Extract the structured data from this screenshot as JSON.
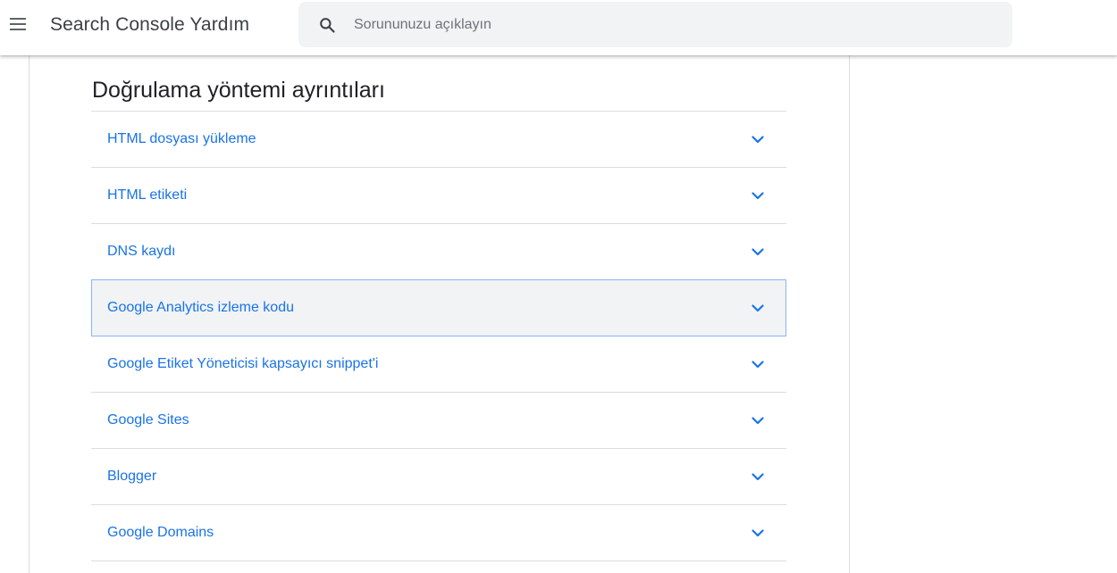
{
  "header": {
    "app_title": "Search Console Yardım",
    "menu_icon": "hamburger-menu-icon",
    "search": {
      "icon": "search-icon",
      "placeholder": "Sorununuzu açıklayın",
      "value": ""
    }
  },
  "main": {
    "section_title": "Doğrulama yöntemi ayrıntıları",
    "accordion": {
      "items": [
        {
          "label": "HTML dosyası yükleme"
        },
        {
          "label": "HTML etiketi"
        },
        {
          "label": "DNS kaydı"
        },
        {
          "label": "Google Analytics izleme kodu"
        },
        {
          "label": "Google Etiket Yöneticisi kapsayıcı snippet'i"
        },
        {
          "label": "Google Sites"
        },
        {
          "label": "Blogger"
        },
        {
          "label": "Google Domains"
        }
      ],
      "expand_icon": "chevron-down-icon",
      "focused_item": "Google Analytics izleme kodu"
    }
  },
  "colors": {
    "link": "#1a73e8",
    "title_text": "#202124",
    "header_text": "#3c4043",
    "search_bg": "#f1f3f4",
    "divider": "#dadce0",
    "focus_border": "#8ab4f8"
  }
}
